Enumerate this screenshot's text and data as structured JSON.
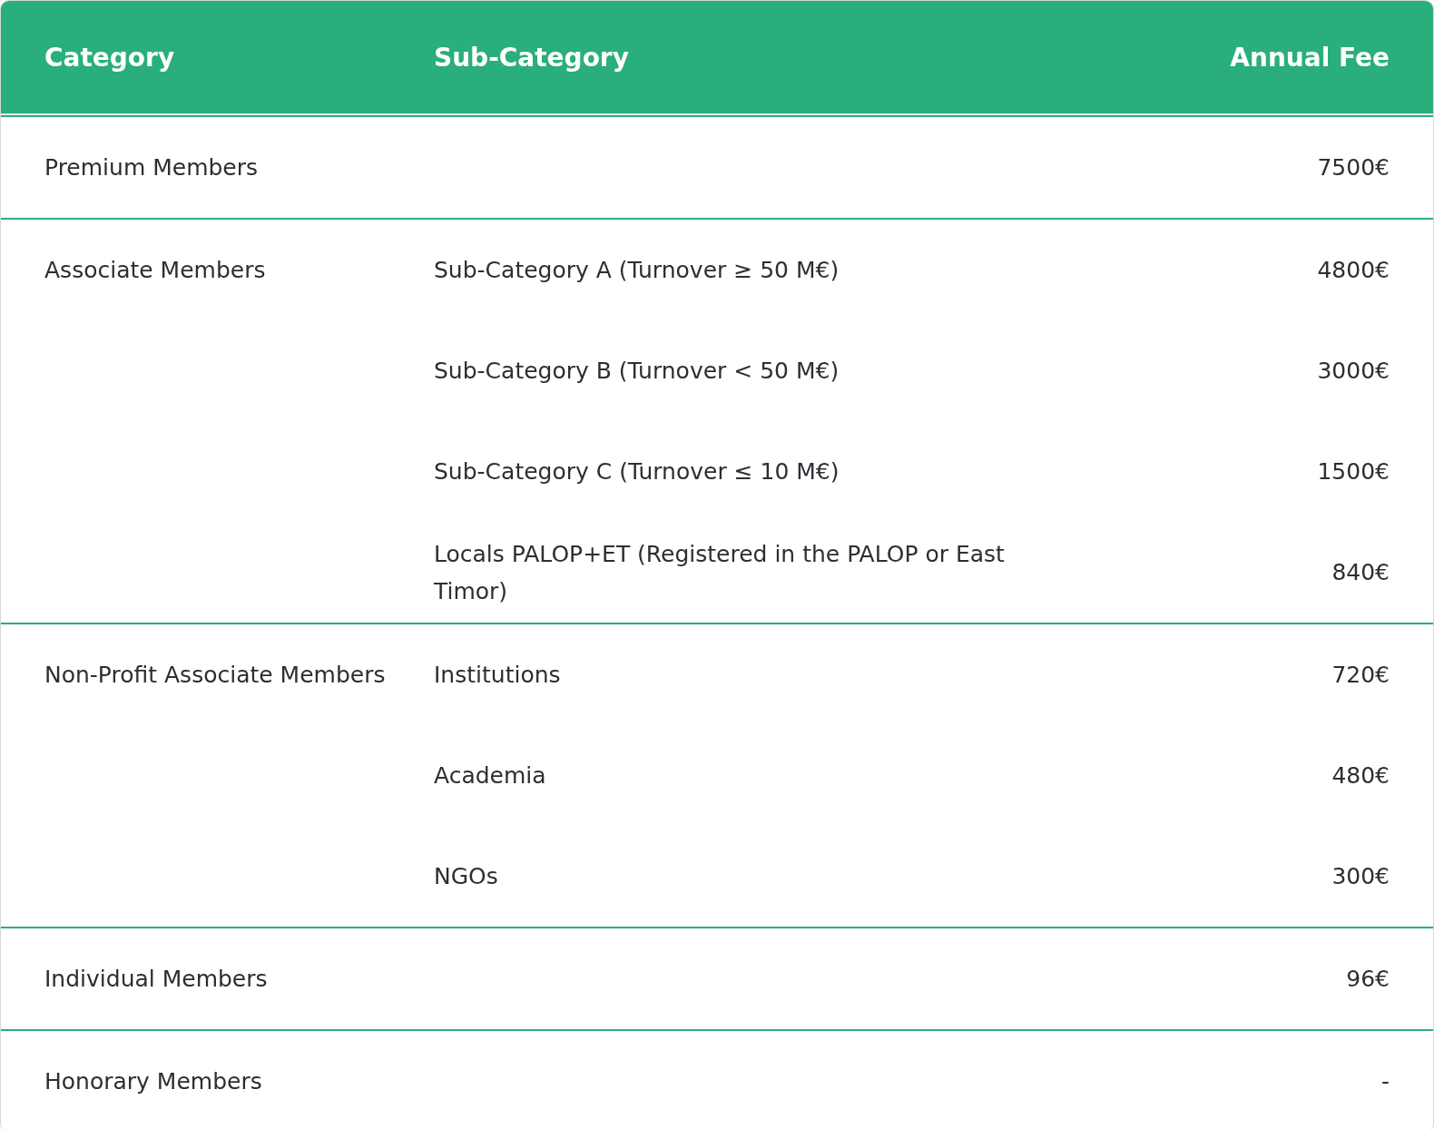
{
  "table": {
    "columns": [
      "Category",
      "Sub-Category",
      "Annual Fee"
    ],
    "groups": [
      {
        "category": "Premium Members",
        "rows": [
          {
            "fee": "7500€"
          }
        ]
      },
      {
        "category": "Associate Members",
        "rows": [
          {
            "sub_category": "Sub-Category A (Turnover ≥ 50 M€)",
            "fee": "4800€"
          },
          {
            "sub_category": "Sub-Category B (Turnover < 50 M€)",
            "fee": "3000€"
          },
          {
            "sub_category": "Sub-Category C (Turnover ≤ 10 M€)",
            "fee": "1500€"
          },
          {
            "sub_category": "Locals PALOP+ET (Registered in the PALOP or East Timor)",
            "fee": "840€"
          }
        ]
      },
      {
        "category": "Non-Profit Associate Members",
        "rows": [
          {
            "sub_category": "Institutions",
            "fee": "720€"
          },
          {
            "sub_category": "Academia",
            "fee": "480€"
          },
          {
            "sub_category": "NGOs",
            "fee": "300€"
          }
        ]
      },
      {
        "category": "Individual Members",
        "rows": [
          {
            "fee": "96€"
          }
        ]
      },
      {
        "category": "Honorary Members",
        "rows": [
          {
            "fee": "-"
          }
        ]
      }
    ]
  }
}
